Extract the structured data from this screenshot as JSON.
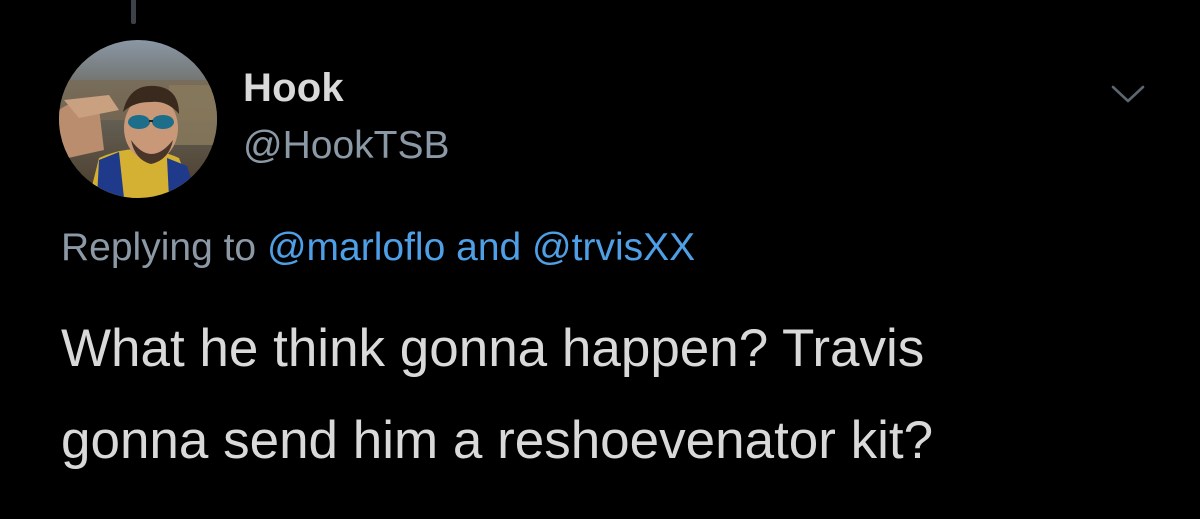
{
  "tweet": {
    "display_name": "Hook",
    "handle": "@HookTSB",
    "reply": {
      "prefix": "Replying to",
      "mention_1": "@marloflo",
      "conjunction": "and",
      "mention_2": "@trvisXX"
    },
    "text_line_1": "What he think gonna happen? Travis",
    "text_line_2": "gonna send him a reshoevenator kit?"
  },
  "icons": {
    "avatar": "profile-photo",
    "menu": "chevron-down-icon"
  },
  "colors": {
    "background": "#000000",
    "primary_text": "#d9d9d9",
    "secondary_text": "#8b98a5",
    "link": "#4e9fe6"
  }
}
